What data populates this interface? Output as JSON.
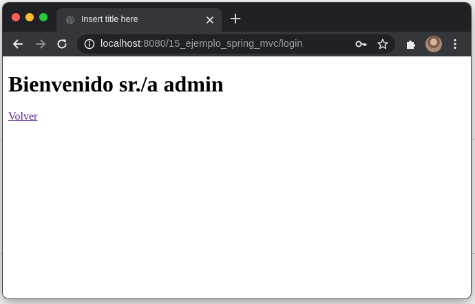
{
  "browser": {
    "tab": {
      "title": "Insert title here"
    },
    "address_bar": {
      "host": "localhost",
      "path": ":8080/15_ejemplo_spring_mvc/login"
    }
  },
  "page": {
    "heading": "Bienvenido sr./a admin",
    "back_link": "Volver"
  },
  "colors": {
    "tabstrip": "#202124",
    "toolbar": "#35363a",
    "visited_link": "#551a8b"
  }
}
